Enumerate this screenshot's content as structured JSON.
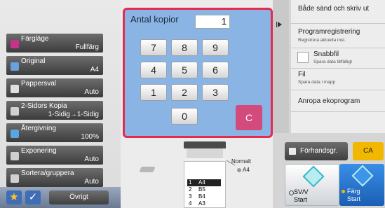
{
  "functions": [
    {
      "label": "Färgläge",
      "value": "Fullfärg",
      "color": "#c7338a"
    },
    {
      "label": "Original",
      "value": "A4",
      "color": "#6aa0dc"
    },
    {
      "label": "Pappersval",
      "value": "Auto",
      "color": "#d8d8d8"
    },
    {
      "label": "2-Sidors Kopia",
      "value": "1-Sidig→1-Sidig",
      "color": "#d8d8d8"
    },
    {
      "label": "Återgivning",
      "value": "100%",
      "color": "#5aa6e0"
    },
    {
      "label": "Exponering",
      "value": "Auto",
      "color": "#d8d8d8"
    },
    {
      "label": "Sortera/gruppera",
      "value": "Auto",
      "color": "#d8d8d8"
    }
  ],
  "bottom": {
    "star_icon": "star-icon",
    "check_icon": "check-icon",
    "other_label": "Övrigt"
  },
  "keypad": {
    "title": "Antal kopior",
    "count": "1",
    "keys": [
      "7",
      "8",
      "9",
      "4",
      "5",
      "6",
      "1",
      "2",
      "3",
      "0"
    ],
    "clear_label": "C",
    "accent": "#e52b50"
  },
  "preview": {
    "mode_label": "Normalt",
    "paper_label": "A4",
    "trays": [
      {
        "num": "1",
        "size": "A4"
      },
      {
        "num": "2",
        "size": "B5"
      },
      {
        "num": "3",
        "size": "B4"
      },
      {
        "num": "4",
        "size": "A3"
      }
    ]
  },
  "menu": {
    "items": [
      {
        "title": "Både sänd och skriv ut",
        "sub": ""
      },
      {
        "title": "Programregistrering",
        "sub": "Registrera aktuella inst."
      },
      {
        "title": "Snabbfil",
        "sub": "Spara data tillfälligt"
      },
      {
        "title": "Fil",
        "sub": "Spara data i mapp"
      },
      {
        "title": "Anropa ekoprogram",
        "sub": ""
      }
    ]
  },
  "actions": {
    "preview_label": "Förhandsgr.",
    "ca_label": "CA",
    "start_bw": [
      "SV/V",
      "Start"
    ],
    "start_color": [
      "Färg",
      "Start"
    ]
  }
}
